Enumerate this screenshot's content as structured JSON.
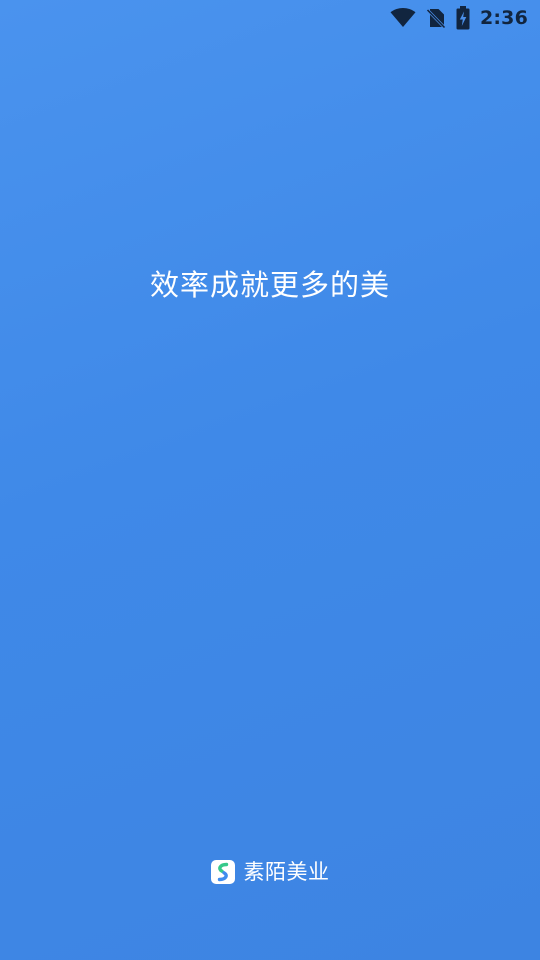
{
  "status_bar": {
    "time": "2:36",
    "icons": [
      "wifi-icon",
      "no-sim-icon",
      "battery-charging-icon"
    ],
    "icon_color": "#11253f"
  },
  "splash": {
    "slogan": "效率成就更多的美",
    "background_color": "#4089e8"
  },
  "brand": {
    "logo_icon": "app-logo-icon",
    "name": "素陌美业",
    "logo_colors": [
      "#36c98a",
      "#3f8cee"
    ]
  }
}
